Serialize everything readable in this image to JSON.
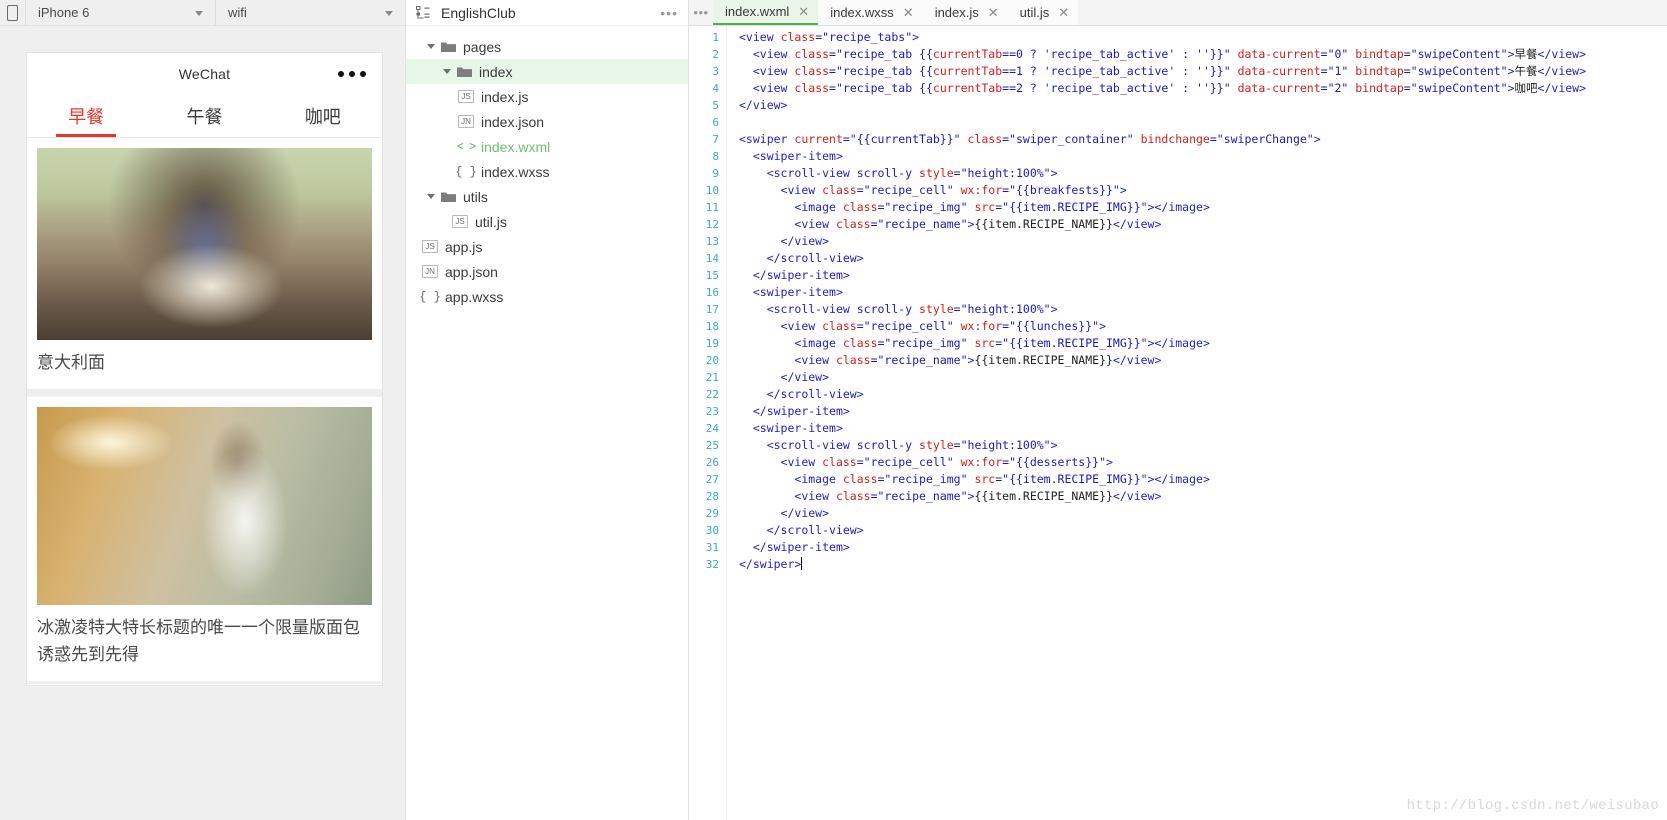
{
  "simulator": {
    "device_label": "iPhone 6",
    "network_label": "wifi",
    "phone_icon": "phone-outline-icon",
    "preview": {
      "nav_title": "WeChat",
      "menu_icon": "more-dots-icon",
      "tabs": [
        {
          "label": "早餐",
          "active": true
        },
        {
          "label": "午餐",
          "active": false
        },
        {
          "label": "咖吧",
          "active": false
        }
      ],
      "cells": [
        {
          "name": "意大利面",
          "image": "pasta-photo"
        },
        {
          "name": "冰激凌特大特长标题的唯一一个限量版面包诱惑先到先得",
          "image": "runner-photo"
        }
      ]
    }
  },
  "tree": {
    "project_icon": "project-structure-icon",
    "project_name": "EnglishClub",
    "more_icon": "more-dots-icon",
    "items": [
      {
        "label": "pages",
        "kind": "folder",
        "depth": 0,
        "expanded": true,
        "selected": false
      },
      {
        "label": "index",
        "kind": "folder",
        "depth": 1,
        "expanded": true,
        "selected": true
      },
      {
        "label": "index.js",
        "kind": "js",
        "depth": 2,
        "expanded": null,
        "selected": false
      },
      {
        "label": "index.json",
        "kind": "json",
        "depth": 2,
        "expanded": null,
        "selected": false
      },
      {
        "label": "index.wxml",
        "kind": "wxml",
        "depth": 2,
        "expanded": null,
        "selected": false
      },
      {
        "label": "index.wxss",
        "kind": "wxss",
        "depth": 2,
        "expanded": null,
        "selected": false
      },
      {
        "label": "utils",
        "kind": "folder",
        "depth": 0,
        "expanded": true,
        "selected": false
      },
      {
        "label": "util.js",
        "kind": "js",
        "depth": 1,
        "expanded": null,
        "selected": false
      },
      {
        "label": "app.js",
        "kind": "js",
        "depth": 0,
        "expanded": null,
        "selected": false
      },
      {
        "label": "app.json",
        "kind": "json",
        "depth": 0,
        "expanded": null,
        "selected": false
      },
      {
        "label": "app.wxss",
        "kind": "wxss",
        "depth": 0,
        "expanded": null,
        "selected": false
      }
    ],
    "badges": {
      "js": "JS",
      "json": "JN",
      "wxml": "< >",
      "wxss": "{ }"
    }
  },
  "editor": {
    "menu_icon": "more-dots-icon",
    "tabs": [
      {
        "label": "index.wxml",
        "active": true
      },
      {
        "label": "index.wxss",
        "active": false
      },
      {
        "label": "index.js",
        "active": false
      },
      {
        "label": "util.js",
        "active": false
      }
    ],
    "close_icon": "close-icon",
    "line_numbers": [
      1,
      2,
      3,
      4,
      5,
      6,
      7,
      8,
      9,
      10,
      11,
      12,
      13,
      14,
      15,
      16,
      17,
      18,
      19,
      20,
      21,
      22,
      23,
      24,
      25,
      26,
      27,
      28,
      29,
      30,
      31,
      32
    ],
    "lines": [
      "<view class=\"recipe_tabs\">",
      "  <view class=\"recipe_tab {{currentTab==0 ? 'recipe_tab_active' : ''}}\" data-current=\"0\" bindtap=\"swipeContent\">早餐</view>",
      "  <view class=\"recipe_tab {{currentTab==1 ? 'recipe_tab_active' : ''}}\" data-current=\"1\" bindtap=\"swipeContent\">午餐</view>",
      "  <view class=\"recipe_tab {{currentTab==2 ? 'recipe_tab_active' : ''}}\" data-current=\"2\" bindtap=\"swipeContent\">咖吧</view>",
      "</view>",
      "",
      "<swiper current=\"{{currentTab}}\" class=\"swiper_container\" bindchange=\"swiperChange\">",
      "  <swiper-item>",
      "    <scroll-view scroll-y style=\"height:100%\">",
      "      <view class=\"recipe_cell\" wx:for=\"{{breakfests}}\">",
      "        <image class=\"recipe_img\" src=\"{{item.RECIPE_IMG}}\"></image>",
      "        <view class=\"recipe_name\">{{item.RECIPE_NAME}}</view>",
      "      </view>",
      "    </scroll-view>",
      "  </swiper-item>",
      "  <swiper-item>",
      "    <scroll-view scroll-y style=\"height:100%\">",
      "      <view class=\"recipe_cell\" wx:for=\"{{lunches}}\">",
      "        <image class=\"recipe_img\" src=\"{{item.RECIPE_IMG}}\"></image>",
      "        <view class=\"recipe_name\">{{item.RECIPE_NAME}}</view>",
      "      </view>",
      "    </scroll-view>",
      "  </swiper-item>",
      "  <swiper-item>",
      "    <scroll-view scroll-y style=\"height:100%\">",
      "      <view class=\"recipe_cell\" wx:for=\"{{desserts}}\">",
      "        <image class=\"recipe_img\" src=\"{{item.RECIPE_IMG}}\"></image>",
      "        <view class=\"recipe_name\">{{item.RECIPE_NAME}}</view>",
      "      </view>",
      "    </scroll-view>",
      "  </swiper-item>",
      "</swiper>"
    ],
    "cursor_line": 32
  },
  "watermark": "http://blog.csdn.net/weisubao",
  "colors": {
    "accent_green": "#4caf50",
    "tab_active_red": "#e8352e",
    "selected_row": "#e8f5e9",
    "line_number": "#3ba7d4",
    "wxml_label": "#6cc070"
  }
}
